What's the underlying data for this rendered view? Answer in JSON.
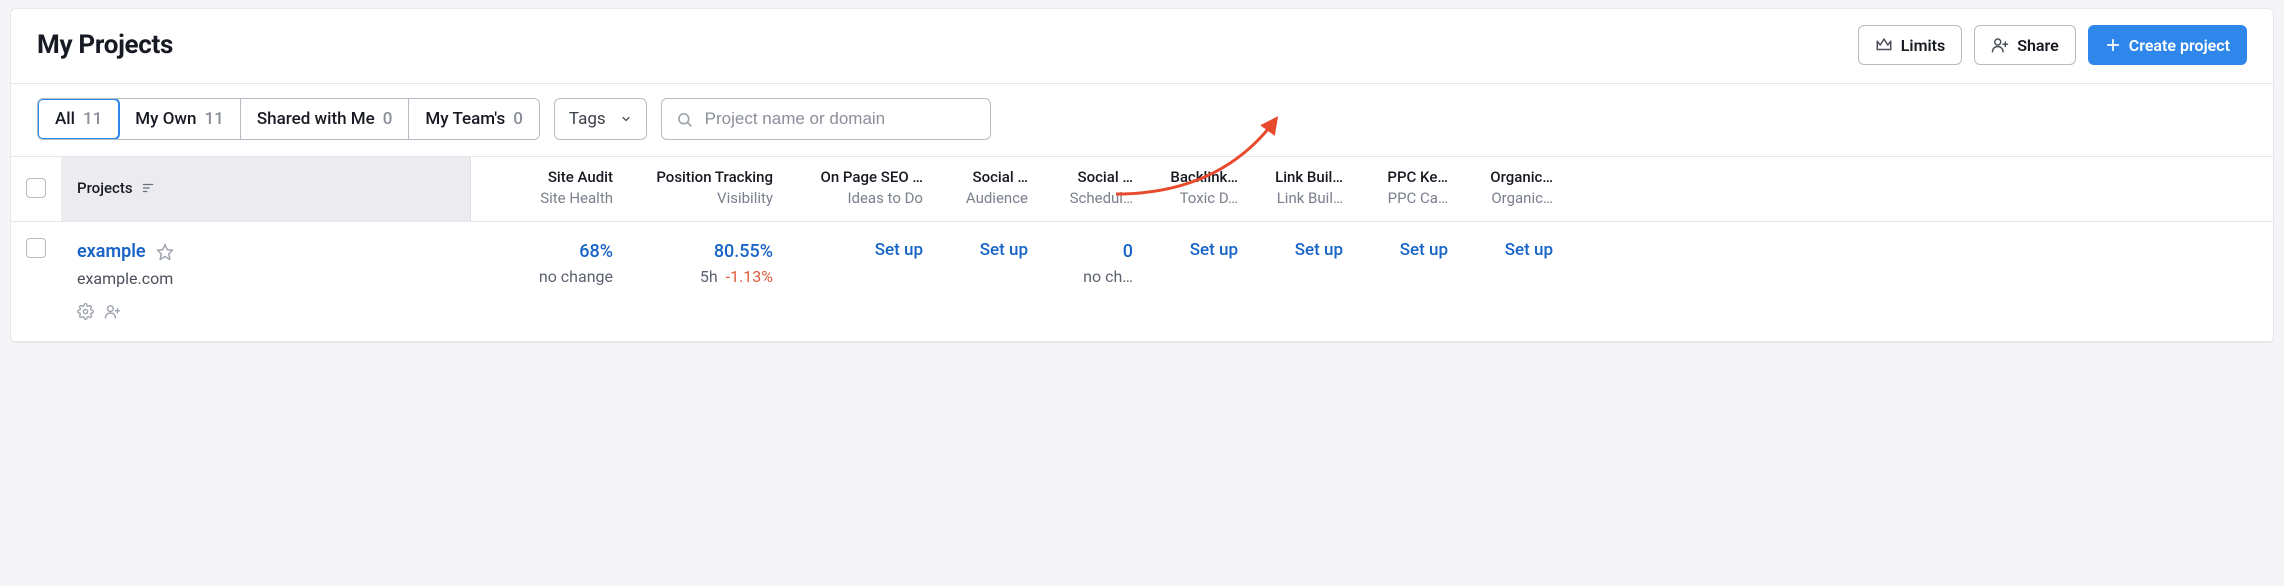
{
  "header": {
    "title": "My Projects",
    "limits_label": "Limits",
    "share_label": "Share",
    "create_label": "Create project"
  },
  "filters": {
    "tabs": [
      {
        "label": "All",
        "count": "11",
        "selected": true
      },
      {
        "label": "My Own",
        "count": "11",
        "selected": false
      },
      {
        "label": "Shared with Me",
        "count": "0",
        "selected": false
      },
      {
        "label": "My Team's",
        "count": "0",
        "selected": false
      }
    ],
    "tags_label": "Tags",
    "search_placeholder": "Project name or domain"
  },
  "columns": {
    "projects": "Projects",
    "cols": [
      {
        "title": "Site Audit",
        "sub": "Site Health"
      },
      {
        "title": "Position Tracking",
        "sub": "Visibility"
      },
      {
        "title": "On Page SEO …",
        "sub": "Ideas to Do"
      },
      {
        "title": "Social …",
        "sub": "Audience"
      },
      {
        "title": "Social …",
        "sub": "Schedul…"
      },
      {
        "title": "Backlink…",
        "sub": "Toxic D…"
      },
      {
        "title": "Link Buil…",
        "sub": "Link Buil…"
      },
      {
        "title": "PPC Ke…",
        "sub": "PPC Ca…"
      },
      {
        "title": "Organic…",
        "sub": "Organic…"
      }
    ]
  },
  "row": {
    "name": "example",
    "domain": "example.com",
    "site_audit": {
      "value": "68%",
      "delta": "no change"
    },
    "position_tracking": {
      "value": "80.55%",
      "age": "5h",
      "delta": "-1.13%"
    },
    "on_page": "Set up",
    "social_audience": "Set up",
    "social_schedule": {
      "value": "0",
      "delta": "no ch…"
    },
    "backlink": "Set up",
    "link_building": "Set up",
    "ppc": "Set up",
    "organic": "Set up"
  }
}
